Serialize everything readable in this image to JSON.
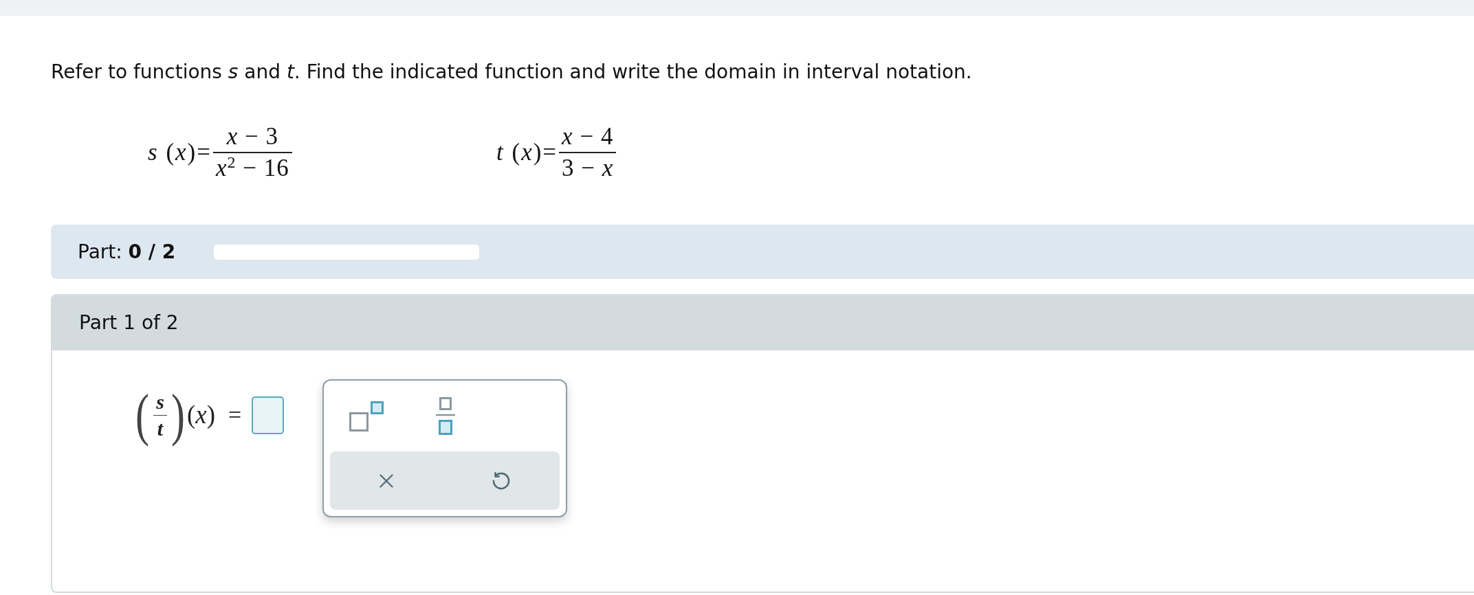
{
  "instructions": "Refer to functions *s* and *t*. Find the indicated function and write the domain in interval notation.",
  "functions": [
    {
      "lhs": "*s* (*x*)=",
      "numerator": "*x* − 3",
      "denominator": "*x*$^{2}$ − 16"
    },
    {
      "lhs": "*t* (*x*)=",
      "numerator": "*x* − 4",
      "denominator": "3 − *x*"
    }
  ],
  "progress": {
    "text": "Part: **0 / 2**",
    "level": 0
  },
  "part": {
    "title": "Part 1 of 2",
    "expression": {
      "open": "(",
      "numerator": "s",
      "denominator": "t",
      "close": ")",
      "argument": "(*x*)",
      "equals": "="
    },
    "keypad": {
      "templates": [
        {
          "kind": "superscript"
        },
        {
          "kind": "fraction"
        }
      ],
      "actions": [
        {
          "kind": "clear"
        },
        {
          "kind": "undo"
        }
      ]
    }
  }
}
